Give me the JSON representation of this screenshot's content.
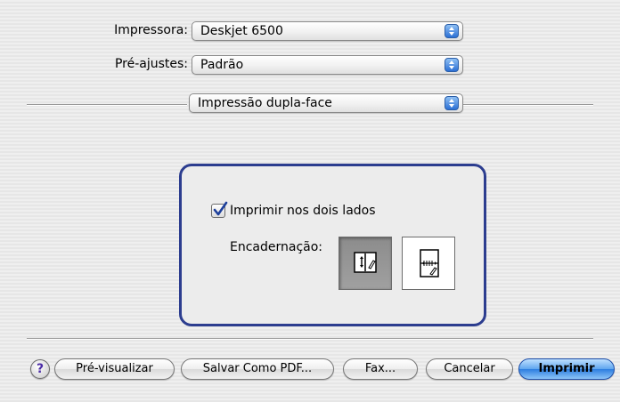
{
  "printer": {
    "label": "Impressora:",
    "value": "Deskjet 6500"
  },
  "presets": {
    "label": "Pré-ajustes:",
    "value": "Padrão"
  },
  "panel_menu": {
    "value": "Impressão dupla-face"
  },
  "duplex": {
    "checkbox_label": "Imprimir nos dois lados",
    "checked": true,
    "binding_label": "Encadernação:",
    "binding_options": [
      "side-binding-icon",
      "top-binding-icon"
    ],
    "selected_binding": "side-binding-icon"
  },
  "buttons": {
    "help": "?",
    "preview": "Pré-visualizar",
    "save_pdf": "Salvar Como PDF...",
    "fax": "Fax...",
    "cancel": "Cancelar",
    "print": "Imprimir"
  },
  "colors": {
    "accent": "#2c7de0",
    "group_border": "#2c3d8f"
  }
}
